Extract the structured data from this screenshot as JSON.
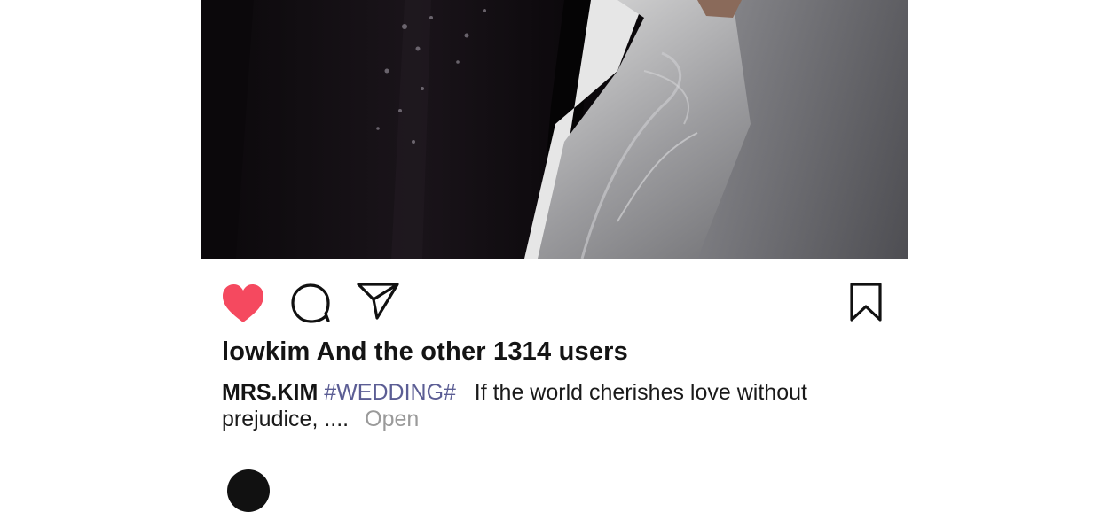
{
  "post": {
    "likes_text": "lowkim And the other 1314 users",
    "caption": {
      "username": "MRS.KIM",
      "hashtag": "#WEDDING#",
      "text_line1": "If the world cherishes love without",
      "text_line2": "prejudice, ....",
      "more_label": "Open"
    },
    "icons": {
      "like": "heart-icon",
      "comment": "speech-bubble-icon",
      "share": "paper-plane-icon",
      "save": "bookmark-icon"
    },
    "colors": {
      "like_active": "#f5495f",
      "hashtag": "#5b5d94",
      "more_link": "#9a9a9a"
    }
  }
}
